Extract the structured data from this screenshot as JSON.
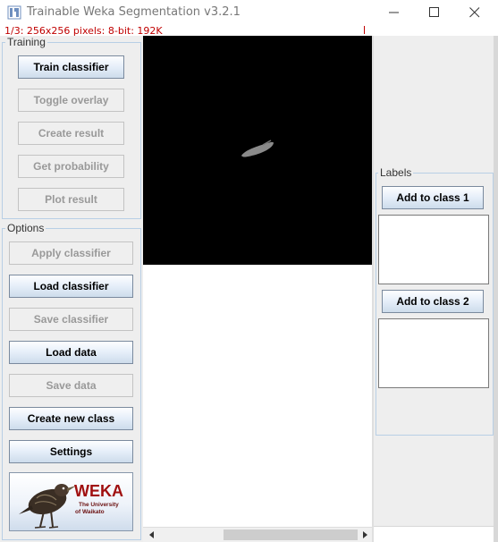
{
  "window": {
    "title": "Trainable Weka Segmentation v3.2.1",
    "controls": [
      "minimize-icon",
      "maximize-icon",
      "close-icon"
    ]
  },
  "status_line": "1/3: 256x256 pixels: 8-bit: 192K",
  "training": {
    "title": "Training",
    "buttons": [
      {
        "label": "Train classifier",
        "enabled": true
      },
      {
        "label": "Toggle overlay",
        "enabled": false
      },
      {
        "label": "Create result",
        "enabled": false
      },
      {
        "label": "Get probability",
        "enabled": false
      },
      {
        "label": "Plot result",
        "enabled": false
      }
    ]
  },
  "options": {
    "title": "Options",
    "buttons": [
      {
        "label": "Apply classifier",
        "enabled": false
      },
      {
        "label": "Load classifier",
        "enabled": true
      },
      {
        "label": "Save classifier",
        "enabled": false
      },
      {
        "label": "Load data",
        "enabled": true
      },
      {
        "label": "Save data",
        "enabled": false
      },
      {
        "label": "Create new class",
        "enabled": true
      },
      {
        "label": "Settings",
        "enabled": true
      }
    ]
  },
  "logo": {
    "name": "WEKA",
    "line1": "The University",
    "line2": "of Waikato"
  },
  "labels": {
    "title": "Labels",
    "classes": [
      {
        "button": "Add to class 1",
        "items": []
      },
      {
        "button": "Add to class 2",
        "items": []
      }
    ]
  },
  "colors": {
    "status_text": "#c00000",
    "image_background": "#000000",
    "segment_gray": "#8a8a8a",
    "panel_background": "#eeeeee",
    "group_border": "#b8cfe5",
    "logo_text": "#a01010"
  }
}
